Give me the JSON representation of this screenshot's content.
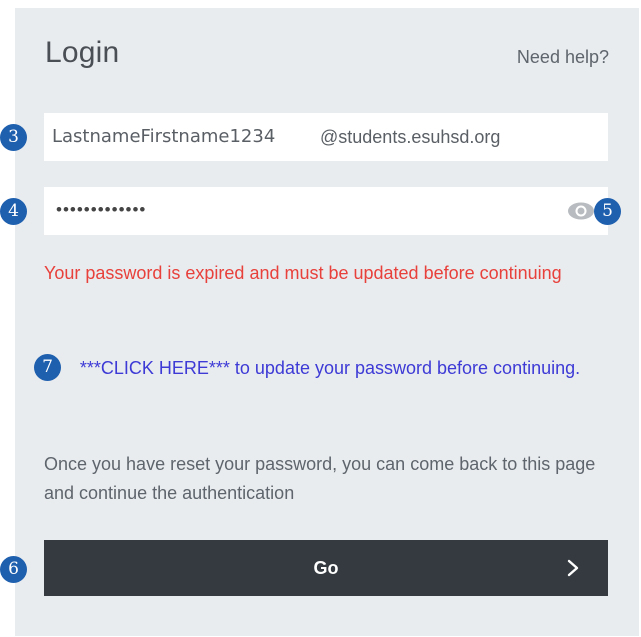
{
  "login": {
    "title": "Login",
    "help_link": "Need help?",
    "email": {
      "username": "LastnameFirstname1234",
      "domain": "@students.esuhsd.org"
    },
    "password": {
      "masked_value": "•••••••••••••",
      "toggle_icon": "eye-icon"
    },
    "error_message": "Your password is expired and must be updated before continuing",
    "update_link": "***CLICK HERE*** to update your password before continuing.",
    "info_message": "Once you have reset your password, you can come back to this page and continue the authentication",
    "go_button": {
      "label": "Go",
      "icon": "chevron-right-icon"
    }
  },
  "markers": {
    "email_field": "3",
    "password_field": "4",
    "eye_toggle": "5",
    "go_button": "6",
    "update_link": "7"
  },
  "colors": {
    "panel_bg": "#e9ecef",
    "error_text": "#e8403b",
    "link_text": "#3d3ad6",
    "button_bg": "#343a40",
    "marker_bg": "#1e5fae"
  }
}
